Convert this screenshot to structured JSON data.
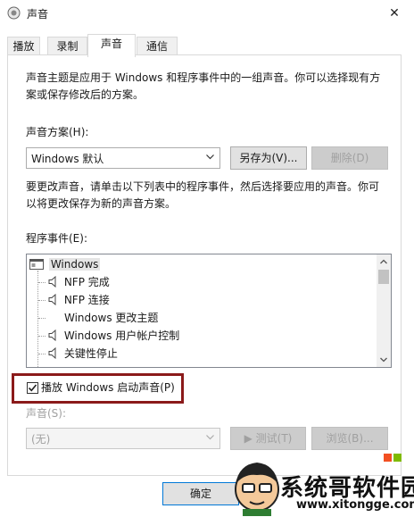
{
  "window": {
    "title": "声音",
    "close_glyph": "✕"
  },
  "tabs": [
    {
      "label": "播放",
      "active": false
    },
    {
      "label": "录制",
      "active": false
    },
    {
      "label": "声音",
      "active": true
    },
    {
      "label": "通信",
      "active": false
    }
  ],
  "intro_text_line1": "声音主题是应用于 Windows 和程序事件中的一组声音。你可以选择现有方",
  "intro_text_line2": "案或保存修改后的方案。",
  "scheme": {
    "label": "声音方案(H):",
    "value": "Windows 默认",
    "save_as_label": "另存为(V)...",
    "delete_label": "删除(D)"
  },
  "change_text_line1": "要更改声音，请单击以下列表中的程序事件，然后选择要应用的声音。你可",
  "change_text_line2": "以将更改保存为新的声音方案。",
  "events": {
    "label": "程序事件(E):",
    "root": "Windows",
    "items": [
      {
        "label": "NFP 完成",
        "has_sound": true
      },
      {
        "label": "NFP 连接",
        "has_sound": true
      },
      {
        "label": "Windows 更改主题",
        "has_sound": false
      },
      {
        "label": "Windows 用户帐户控制",
        "has_sound": true
      },
      {
        "label": "关键性停止",
        "has_sound": true
      }
    ]
  },
  "startup_sound": {
    "label": "播放 Windows 启动声音(P)",
    "checked": true
  },
  "sound": {
    "label": "声音(S):",
    "value": "(无)",
    "test_label": "▶ 测试(T)",
    "browse_label": "浏览(B)..."
  },
  "footer": {
    "ok_label": "确定"
  },
  "watermark": {
    "title": "系统哥软件园",
    "url": "www.xitongge.com"
  },
  "colors": {
    "highlight_border": "#8b1a1a",
    "disabled_text": "#a0a0a0"
  }
}
